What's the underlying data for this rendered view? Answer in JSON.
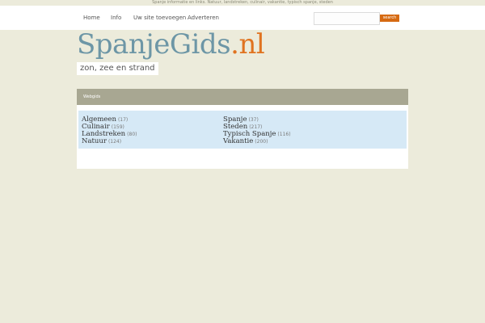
{
  "top_strip": {
    "text": "Spanje informatie en links. Natuur, landstreken, culinair, vakantie, typisch spanje, steden"
  },
  "nav": {
    "items": [
      {
        "label": "Home"
      },
      {
        "label": "Info"
      },
      {
        "label": "Uw site toevoegen"
      },
      {
        "label": "Adverteren"
      }
    ]
  },
  "search": {
    "placeholder": "",
    "value": "",
    "button_label": "search"
  },
  "logo": {
    "main": "SpanjeGids",
    "tld": ".nl",
    "main_color": "#6d96a6",
    "tld_color": "#e07320"
  },
  "tagline": "zon, zee en strand",
  "panel": {
    "title": "Webgids",
    "categories_left": [
      {
        "name": "Algemeen",
        "count": "(17)"
      },
      {
        "name": "Culinair",
        "count": "(159)"
      },
      {
        "name": "Landstreken",
        "count": "(80)"
      },
      {
        "name": "Natuur",
        "count": "(124)"
      }
    ],
    "categories_right": [
      {
        "name": "Spanje",
        "count": "(37)"
      },
      {
        "name": "Steden",
        "count": "(217)"
      },
      {
        "name": "Typisch Spanje",
        "count": "(116)"
      },
      {
        "name": "Vakantie",
        "count": "(200)"
      }
    ]
  },
  "colors": {
    "background": "#ecebdb",
    "accent": "#d66a12",
    "header_bar": "#a8a792",
    "category_box": "#d6e9f6"
  }
}
